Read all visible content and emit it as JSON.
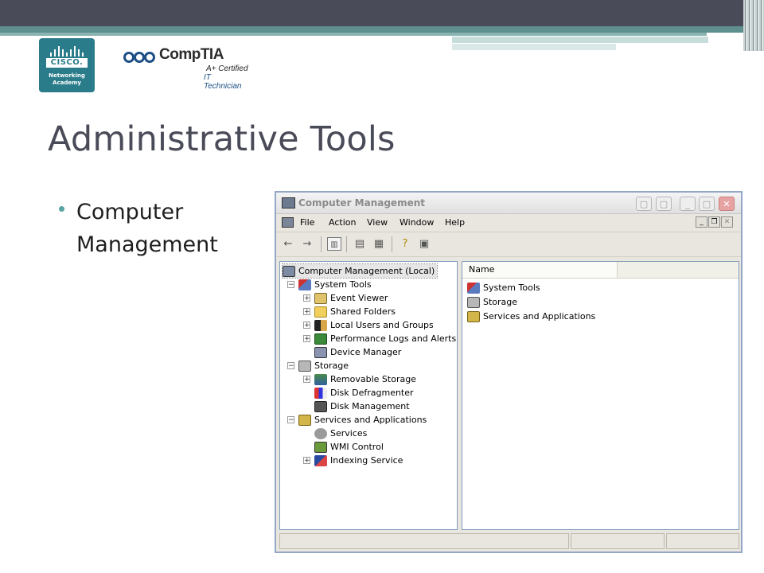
{
  "slide": {
    "title": "Administrative Tools",
    "bullet": "Computer Management"
  },
  "logos": {
    "cisco_word": "CISCO",
    "cisco_tm": ".",
    "cisco_line1": "Networking",
    "cisco_line2": "Academy",
    "comptia_word": "CompTIA",
    "comptia_tag1": "A+ Certified",
    "comptia_tag2": "IT Technician"
  },
  "window": {
    "title": "Computer Management",
    "menu": [
      "File",
      "Action",
      "View",
      "Window",
      "Help"
    ],
    "tree": [
      {
        "label": "Computer Management (Local)",
        "icon": "computer-icon"
      },
      {
        "label": "System Tools",
        "icon": "system-tools-icon"
      },
      {
        "label": "Event Viewer",
        "icon": "event-viewer-icon"
      },
      {
        "label": "Shared Folders",
        "icon": "shared-folders-icon"
      },
      {
        "label": "Local Users and Groups",
        "icon": "users-icon"
      },
      {
        "label": "Performance Logs and Alerts",
        "icon": "performance-icon"
      },
      {
        "label": "Device Manager",
        "icon": "device-manager-icon"
      },
      {
        "label": "Storage",
        "icon": "storage-icon"
      },
      {
        "label": "Removable Storage",
        "icon": "removable-storage-icon"
      },
      {
        "label": "Disk Defragmenter",
        "icon": "defrag-icon"
      },
      {
        "label": "Disk Management",
        "icon": "disk-management-icon"
      },
      {
        "label": "Services and Applications",
        "icon": "services-apps-icon"
      },
      {
        "label": "Services",
        "icon": "services-icon"
      },
      {
        "label": "WMI Control",
        "icon": "wmi-icon"
      },
      {
        "label": "Indexing Service",
        "icon": "indexing-icon"
      }
    ],
    "list_header": "Name",
    "list_items": [
      {
        "label": "System Tools",
        "icon": "system-tools-icon"
      },
      {
        "label": "Storage",
        "icon": "storage-icon"
      },
      {
        "label": "Services and Applications",
        "icon": "services-apps-icon"
      }
    ],
    "colors": {
      "frame": "#94a7c7",
      "face": "#e9e6df",
      "close": "#e7a2a2"
    }
  },
  "theme": {
    "title_color": "#4a4b58",
    "accent": "#59a3a3",
    "header_bar": "#4a4b58",
    "teal_bar": "#5e8e8e"
  }
}
